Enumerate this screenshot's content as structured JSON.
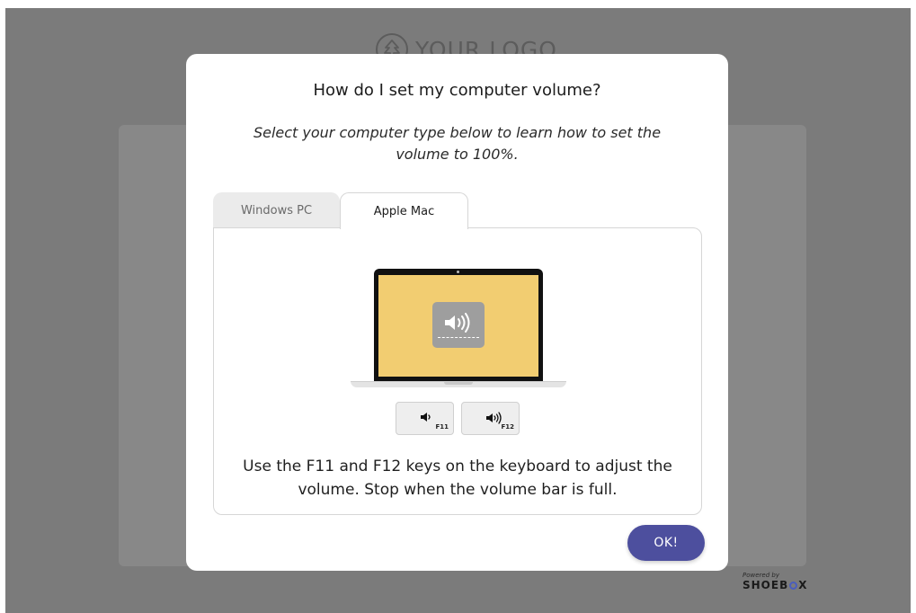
{
  "background": {
    "logo_text": "YOUR LOGO",
    "logo_icon": "tree-icon",
    "powered_by_label": "Powered by",
    "powered_by_brand_left": "SHOEB",
    "powered_by_brand_right": "X",
    "backdrop_color": "#7b7b7b"
  },
  "modal": {
    "title": "How do I set my computer volume?",
    "subtitle": "Select your computer type below to learn how to set the volume to 100%.",
    "tabs": [
      {
        "label": "Windows PC",
        "active": false
      },
      {
        "label": "Apple Mac",
        "active": true
      }
    ],
    "illustration": {
      "screen_color": "#f2cd71",
      "hud_icon": "speaker-volume-icon",
      "keys": [
        {
          "label": "F11",
          "icon": "volume-down-icon"
        },
        {
          "label": "F12",
          "icon": "volume-up-icon"
        }
      ]
    },
    "instruction": "Use the F11 and F12 keys on the keyboard to adjust the volume. Stop when the volume bar is full.",
    "ok_label": "OK!",
    "accent_color": "#4d4f9e"
  }
}
